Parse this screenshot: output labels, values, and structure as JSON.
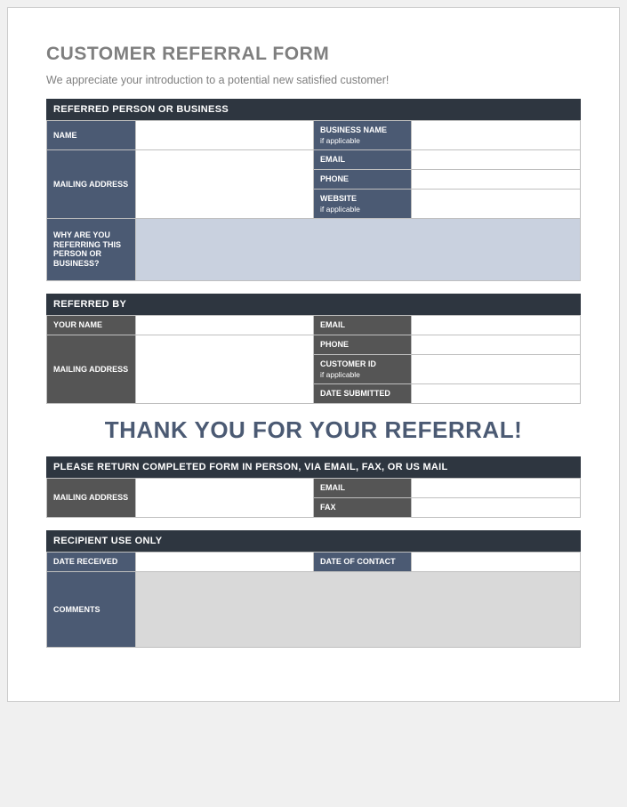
{
  "title": "CUSTOMER REFERRAL FORM",
  "intro": "We appreciate your introduction to a potential new satisfied customer!",
  "section1": {
    "header": "REFERRED PERSON OR BUSINESS",
    "name": "NAME",
    "mailing": "MAILING ADDRESS",
    "business": "BUSINESS NAME",
    "business_sub": "if applicable",
    "email": "EMAIL",
    "phone": "PHONE",
    "website": "WEBSITE",
    "website_sub": "if applicable",
    "why": "WHY ARE YOU REFERRING THIS PERSON OR BUSINESS?"
  },
  "section2": {
    "header": "REFERRED BY",
    "yourname": "YOUR NAME",
    "mailing": "MAILING ADDRESS",
    "email": "EMAIL",
    "phone": "PHONE",
    "custid": "CUSTOMER ID",
    "custid_sub": "if applicable",
    "date": "DATE SUBMITTED"
  },
  "thanks": "THANK YOU FOR YOUR REFERRAL!",
  "section3": {
    "header": "PLEASE RETURN COMPLETED FORM IN PERSON, VIA EMAIL, FAX, OR US MAIL",
    "mailing": "MAILING ADDRESS",
    "email": "EMAIL",
    "fax": "FAX"
  },
  "section4": {
    "header": "RECIPIENT USE ONLY",
    "received": "DATE RECEIVED",
    "contact": "DATE OF CONTACT",
    "comments": "COMMENTS"
  }
}
